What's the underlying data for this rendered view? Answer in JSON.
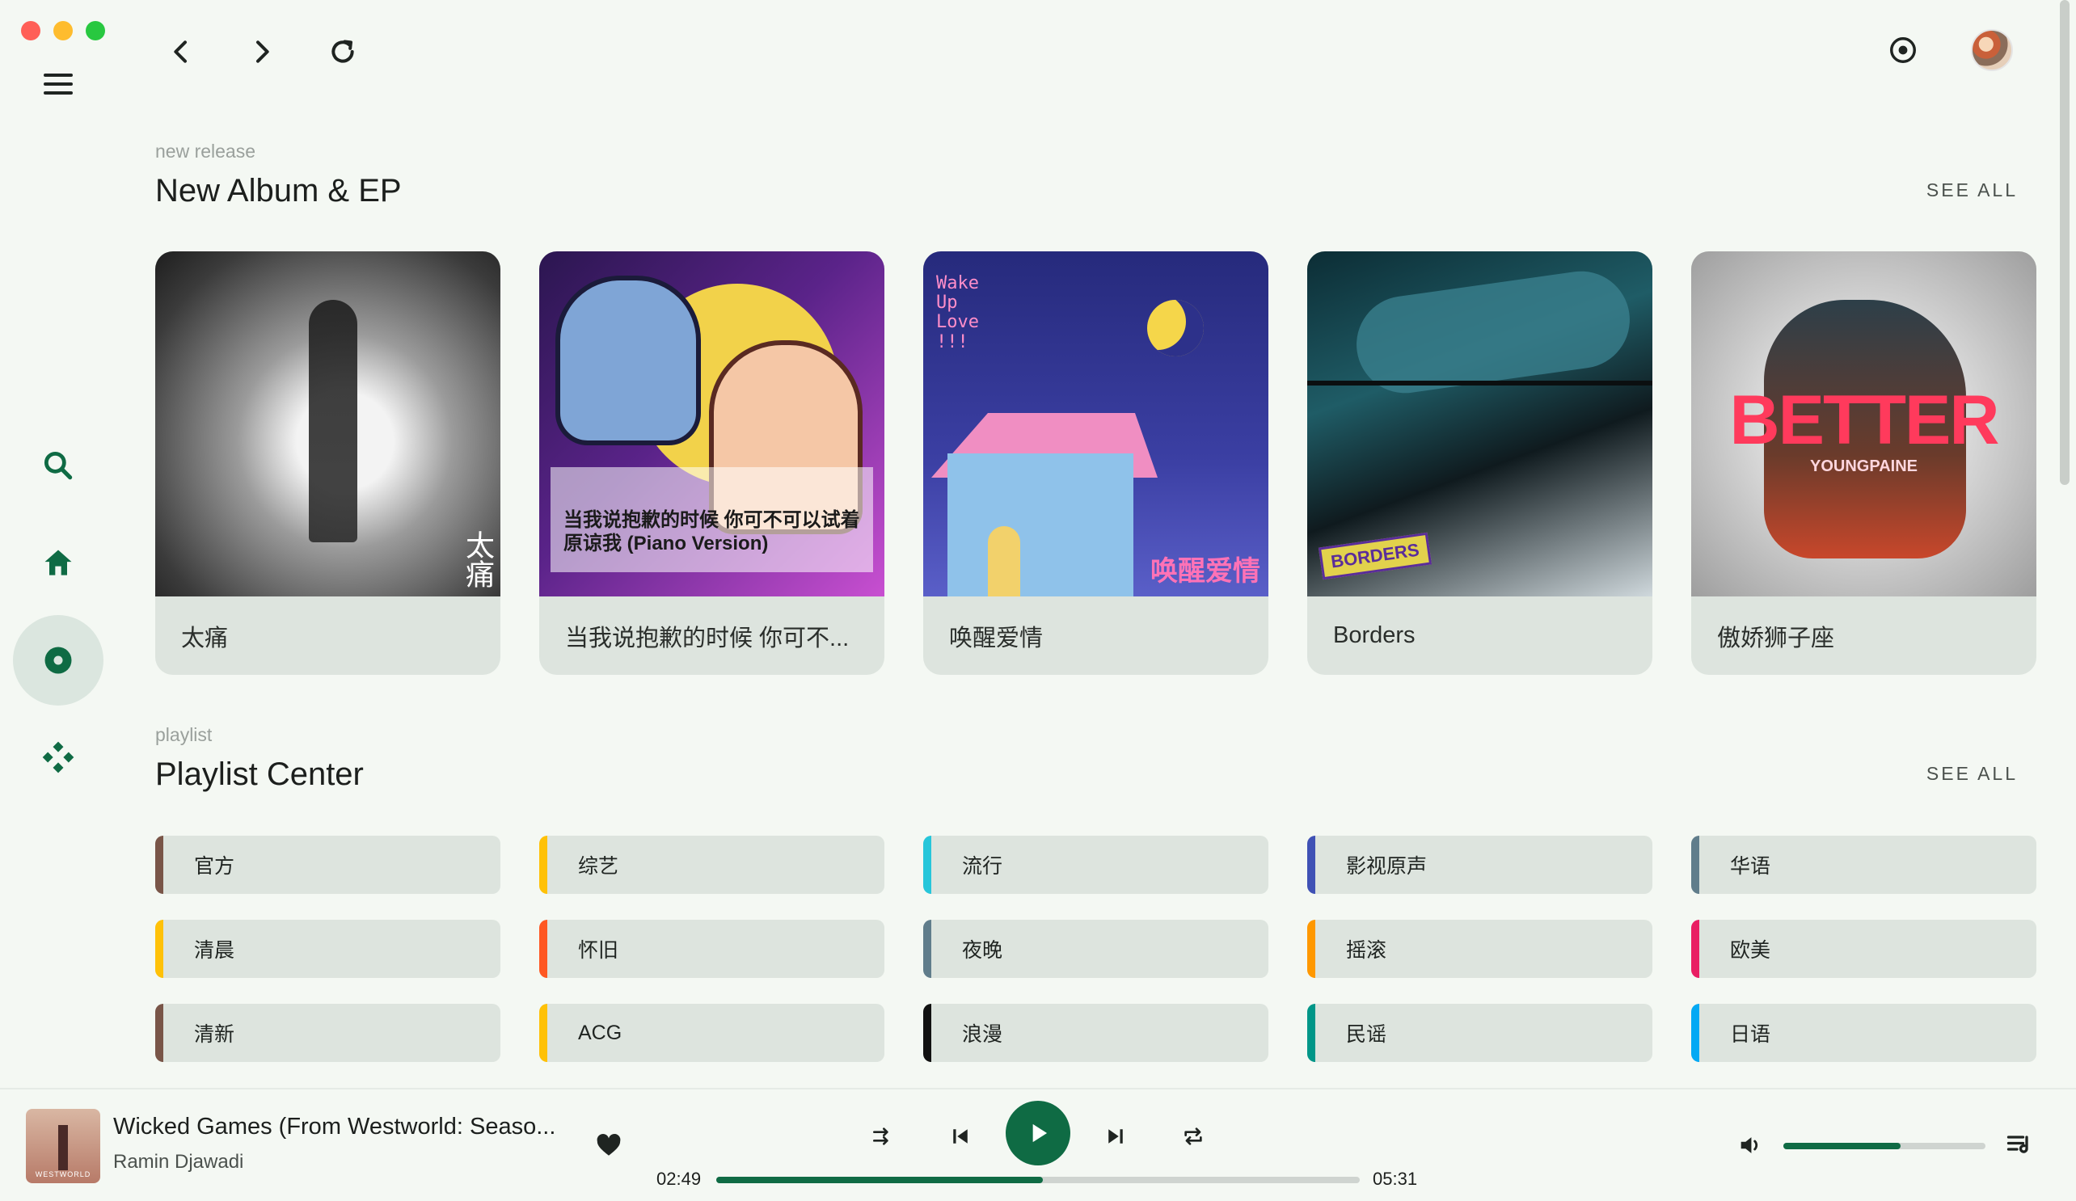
{
  "window": {
    "controls": [
      "close",
      "minimize",
      "maximize"
    ],
    "colors": {
      "close": "#ff5f57",
      "minimize": "#febc2e",
      "maximize": "#28c840"
    }
  },
  "nav": {
    "back_icon": "chevron-left-icon",
    "forward_icon": "chevron-right-icon",
    "refresh_icon": "refresh-icon"
  },
  "sidebar": {
    "items": [
      {
        "name": "search",
        "icon": "search-icon"
      },
      {
        "name": "home",
        "icon": "home-icon"
      },
      {
        "name": "discover",
        "icon": "disc-icon",
        "active": true
      },
      {
        "name": "library",
        "icon": "diamond-grid-icon"
      }
    ]
  },
  "new_release": {
    "kicker": "new release",
    "title": "New Album & EP",
    "see_all": "SEE ALL",
    "albums": [
      {
        "title": "太痛",
        "cover_text": "太痛"
      },
      {
        "title": "当我说抱歉的时候 你可不...",
        "cover_text": "当我说抱歉的时候 你可不可以试着原谅我 (Piano Version)"
      },
      {
        "title": "唤醒爱情",
        "cover_text_top": "Wake Up Love !!!",
        "cover_text_bottom": "唤醒爱情"
      },
      {
        "title": "Borders",
        "cover_text": "BORDERS"
      },
      {
        "title": "傲娇狮子座",
        "cover_text": "BETTER",
        "cover_subtext": "YOUNGPAINE"
      }
    ]
  },
  "playlist": {
    "kicker": "playlist",
    "title": "Playlist Center",
    "see_all": "SEE ALL",
    "items": [
      {
        "label": "官方",
        "color": "#795548"
      },
      {
        "label": "综艺",
        "color": "#ffc107"
      },
      {
        "label": "流行",
        "color": "#26c6da"
      },
      {
        "label": "影视原声",
        "color": "#3f51b5"
      },
      {
        "label": "华语",
        "color": "#607d8b"
      },
      {
        "label": "清晨",
        "color": "#ffc107"
      },
      {
        "label": "怀旧",
        "color": "#ff5722"
      },
      {
        "label": "夜晚",
        "color": "#607d8b"
      },
      {
        "label": "摇滚",
        "color": "#ff9800"
      },
      {
        "label": "欧美",
        "color": "#e91e63"
      },
      {
        "label": "清新",
        "color": "#795548"
      },
      {
        "label": "ACG",
        "color": "#ffc107"
      },
      {
        "label": "浪漫",
        "color": "#111111"
      },
      {
        "label": "民谣",
        "color": "#009688"
      },
      {
        "label": "日语",
        "color": "#03a9f4"
      }
    ]
  },
  "player": {
    "title": "Wicked Games (From Westworld: Seaso...",
    "artist": "Ramin Djawadi",
    "cover_label": "WESTWORLD",
    "current_time": "02:49",
    "total_time": "05:31",
    "progress": 0.508,
    "volume": 0.58,
    "accent": "#0f6b44"
  }
}
